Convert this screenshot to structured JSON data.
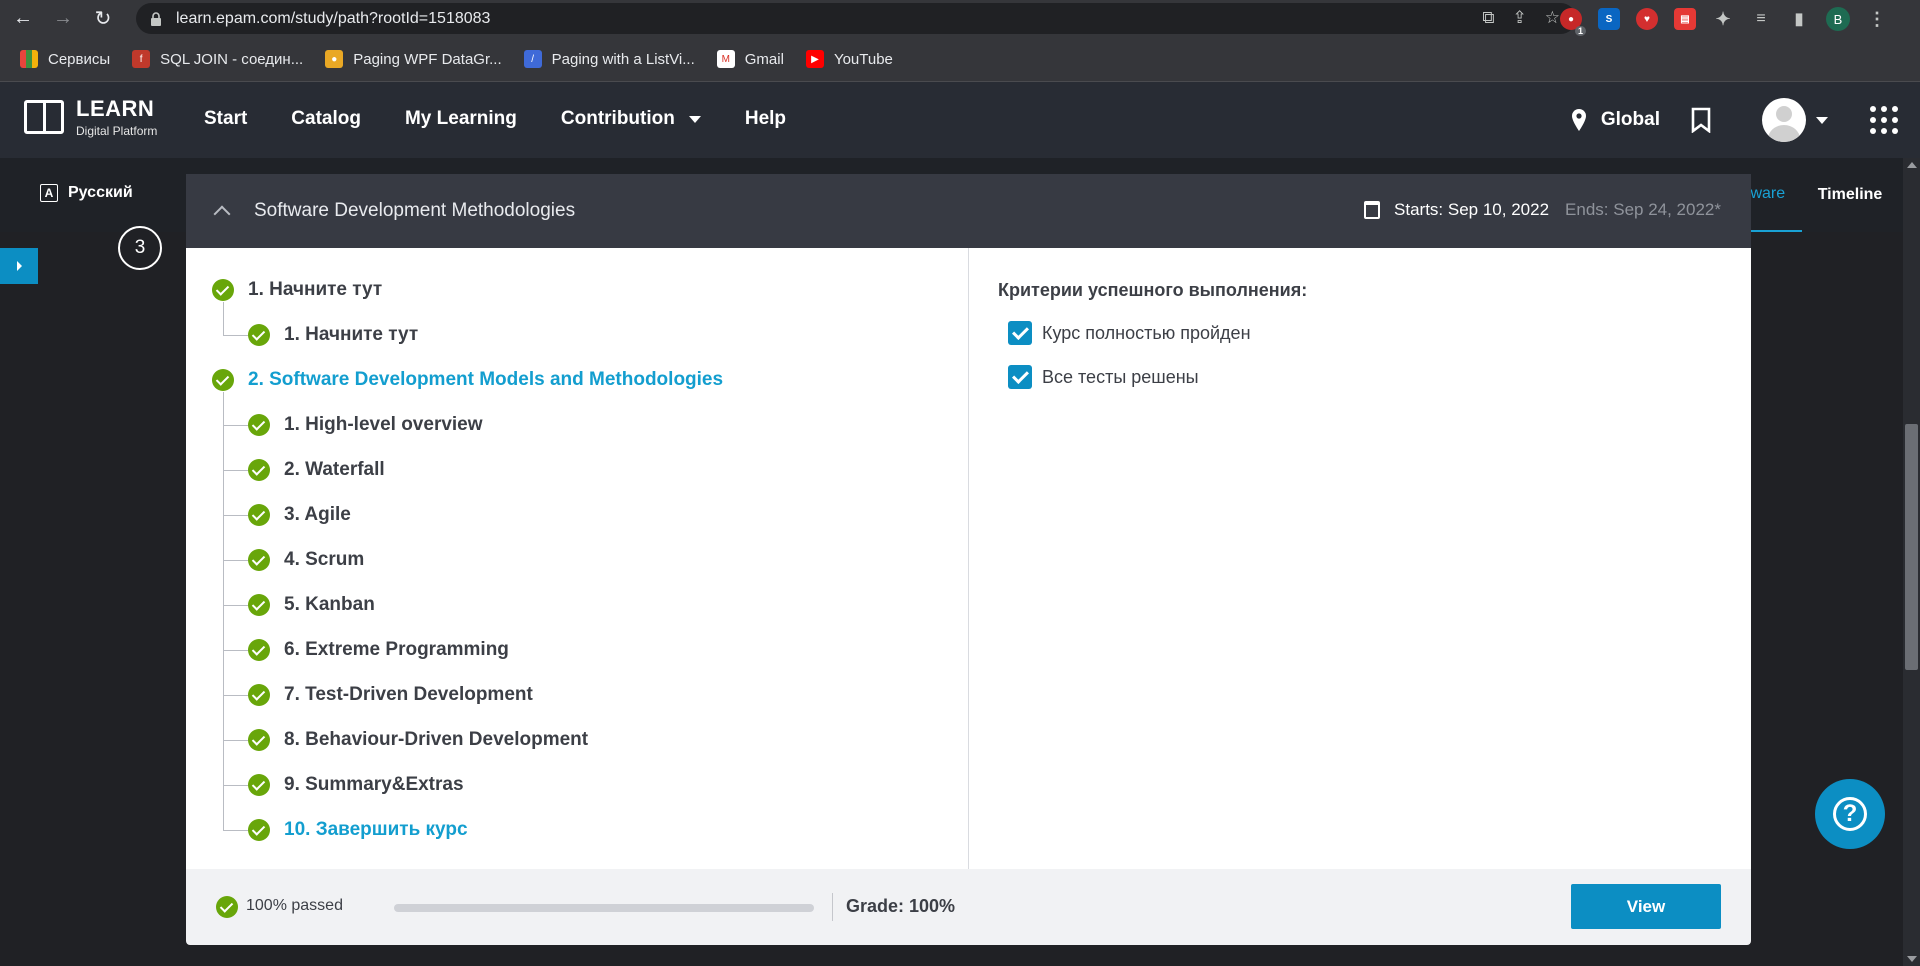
{
  "browser": {
    "url": "learn.epam.com/study/path?rootId=1518083",
    "profile_initial": "B",
    "extension_badge": "1",
    "bookmarks": [
      {
        "label": "Сервисы",
        "icon": "apps-icon",
        "color": "#e8453c"
      },
      {
        "label": "SQL JOIN - соедин...",
        "icon": "function-icon",
        "color": "#c0392b"
      },
      {
        "label": "Paging WPF DataGr...",
        "icon": "site-icon",
        "color": "#e9a825"
      },
      {
        "label": "Paging with a ListVi...",
        "icon": "site-icon",
        "color": "#3f6ad8"
      },
      {
        "label": "Gmail",
        "icon": "gmail-icon",
        "color": "#d93025"
      },
      {
        "label": "YouTube",
        "icon": "youtube-icon",
        "color": "#ff0000"
      }
    ]
  },
  "header": {
    "logo_title": "LEARN",
    "logo_subtitle": "Digital Platform",
    "nav": [
      "Start",
      "Catalog",
      "My Learning",
      "Contribution",
      "Help"
    ],
    "location": "Global"
  },
  "subbar": {
    "language": "Русский",
    "lang_icon": "translate-icon",
    "tabs": [
      "Courseware",
      "Timeline"
    ],
    "step_number": "3"
  },
  "course": {
    "title": "Software Development Methodologies",
    "starts": "Starts: Sep 10, 2022",
    "ends": "Ends: Sep 24, 2022*",
    "tree": [
      {
        "label": "1. Начните тут",
        "level": 0,
        "link": false
      },
      {
        "label": "1. Начните тут",
        "level": 1,
        "link": false
      },
      {
        "label": "2. Software Development Models and Methodologies",
        "level": 0,
        "link": true
      },
      {
        "label": "1. High-level overview",
        "level": 1,
        "link": false
      },
      {
        "label": "2. Waterfall",
        "level": 1,
        "link": false
      },
      {
        "label": "3. Agile",
        "level": 1,
        "link": false
      },
      {
        "label": "4. Scrum",
        "level": 1,
        "link": false
      },
      {
        "label": "5. Kanban",
        "level": 1,
        "link": false
      },
      {
        "label": "6. Extreme Programming",
        "level": 1,
        "link": false
      },
      {
        "label": "7. Test-Driven Development",
        "level": 1,
        "link": false
      },
      {
        "label": "8. Behaviour-Driven Development",
        "level": 1,
        "link": false
      },
      {
        "label": "9. Summary&Extras",
        "level": 1,
        "link": false
      },
      {
        "label": "10. Завершить курс",
        "level": 1,
        "link": true
      }
    ],
    "criteria_title": "Критерии успешного выполнения:",
    "criteria": [
      "Курс полностью пройден",
      "Все тесты решены"
    ]
  },
  "footer": {
    "passed": "100% passed",
    "progress": 1.0,
    "grade": "Grade: 100%",
    "view_label": "View"
  },
  "colors": {
    "accent": "#0c8ec3",
    "success": "#68a60a",
    "link": "#139ecf"
  }
}
